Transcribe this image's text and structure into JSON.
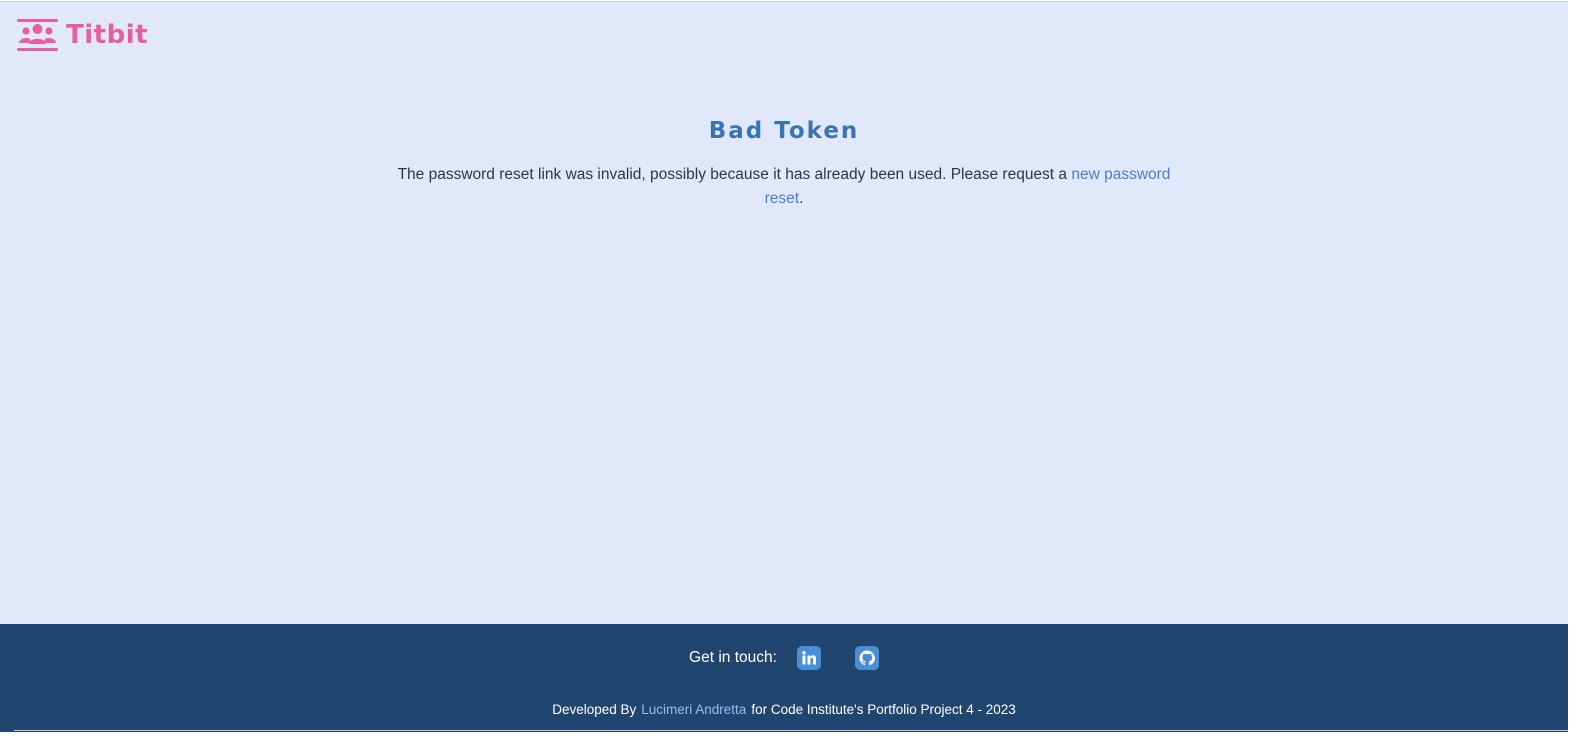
{
  "brand": {
    "name": "Titbit",
    "icon": "users-icon",
    "color": "#e8609a"
  },
  "main": {
    "title": "Bad Token",
    "message_prefix": "The password reset link was invalid, possibly because it has already been used. Please request a ",
    "link_text": "new password reset",
    "message_suffix": "."
  },
  "footer": {
    "contact_label": "Get in touch:",
    "social": [
      {
        "name": "linkedin-icon"
      },
      {
        "name": "github-icon"
      }
    ],
    "credits_prefix": "Developed By",
    "author_name": "Lucimeri Andretta",
    "credits_suffix": "for Code Institute's Portfolio Project 4 - 2023",
    "background": "#20456e"
  },
  "colors": {
    "page_background": "#e1e8fc",
    "title": "#3a74b0",
    "link": "#4a7fc8"
  }
}
